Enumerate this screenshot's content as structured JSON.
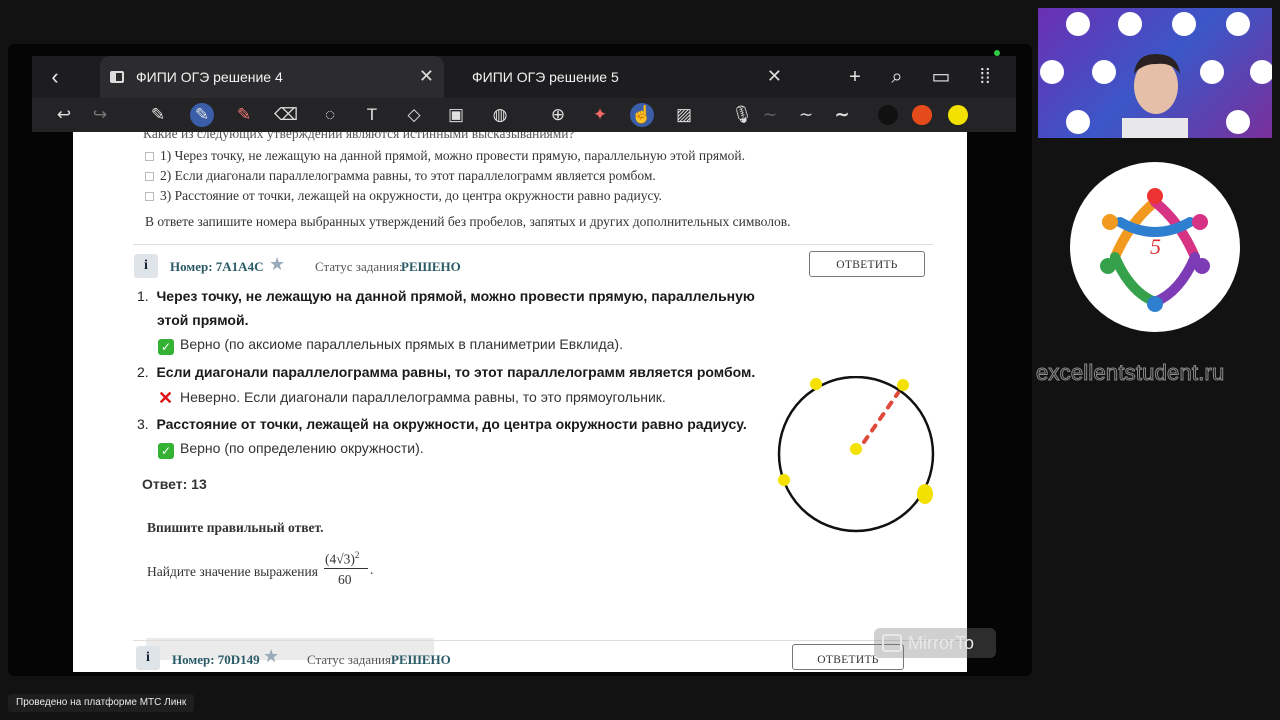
{
  "tabs": [
    {
      "title": "ФИПИ ОГЭ решение 4",
      "close": "✕"
    },
    {
      "title": "ФИПИ ОГЭ решение 5",
      "close": "✕"
    }
  ],
  "icons": {
    "back": "‹",
    "new_tab": "+",
    "search": "⌕",
    "sidebar": "▭",
    "grid": "⁞⁞",
    "undo": "↩",
    "redo": "↪",
    "pen": "✎",
    "highlighter": "✎",
    "marker": "✎",
    "eraser": "⌫",
    "lasso": "◌",
    "text": "T",
    "shapes": "◇",
    "image": "▣",
    "sticker": "◍",
    "zoom": "⊕",
    "laser": "✦",
    "hand": "☝",
    "hatch": "▨",
    "mic": "🎙",
    "stroke1": "∼",
    "stroke2": "∼",
    "stroke3": "∼"
  },
  "colors": {
    "black": "#111111",
    "orange": "#e44a1a",
    "yellow": "#f3e100",
    "accent": "#3a5ea8"
  },
  "question_top": {
    "statements": [
      "1) Через точку, не лежащую на данной прямой, можно провести прямую, параллельную этой прямой.",
      "2) Если диагонали параллелограмма равны, то этот параллелограмм является ромбом.",
      "3) Расстояние от точки, лежащей на окружности, до центра окружности равно радиусу."
    ],
    "instruction": "В ответе запишите номера выбранных утверждений без пробелов, запятых и других дополнительных символов."
  },
  "task1": {
    "info": "i",
    "number_label": "Номер: 7A1A4C",
    "status_label": "Статус задания:",
    "status_value": "РЕШЕНО",
    "answer_button": "ОТВЕТИТЬ"
  },
  "solution": {
    "items": [
      {
        "num": "1.",
        "text_line1": "Через точку, не лежащую на данной прямой, можно провести прямую, параллельную",
        "text_line2": "этой прямой.",
        "mark": "✓",
        "verdict": "Верно (по аксиоме параллельных прямых в планиметрии Евклида)."
      },
      {
        "num": "2.",
        "text_line1": "Если диагонали параллелограмма равны, то этот параллелограмм является ромбом.",
        "mark": "✕",
        "verdict": "Неверно. Если диагонали параллелограмма равны, то это прямоугольник."
      },
      {
        "num": "3.",
        "text_line1": "Расстояние от точки, лежащей на окружности, до центра окружности равно радиусу.",
        "mark": "✓",
        "verdict": "Верно (по определению окружности)."
      }
    ],
    "answer": "Ответ: 13"
  },
  "task2": {
    "prompt": "Впишите правильный ответ.",
    "question_prefix": "Найдите значение выражения",
    "numerator": "(4√3)",
    "exponent": "2",
    "denominator": "60",
    "period": "."
  },
  "task3": {
    "info": "i",
    "number_label": "Номер: 70D149",
    "status_label": "Статус задания:",
    "status_value": "РЕШЕНО",
    "answer_button": "ОТВЕТИТЬ"
  },
  "watermark": "MirrorTo",
  "site": "excellentstudent.ru",
  "logo_number": "5",
  "footer": "Проведено на платформе МТС Линк"
}
